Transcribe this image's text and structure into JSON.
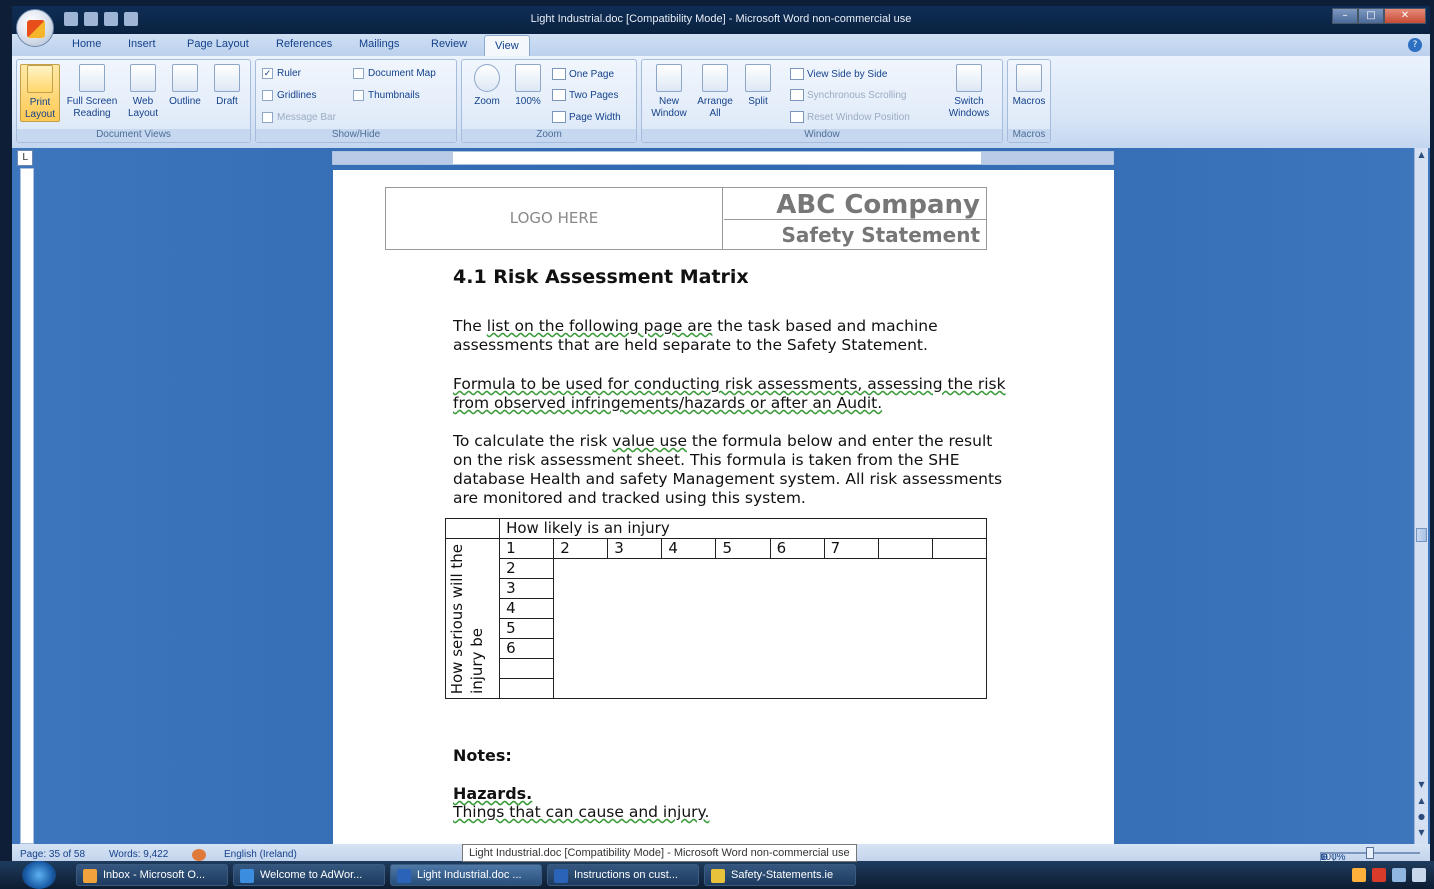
{
  "window": {
    "title": "Light Industrial.doc [Compatibility Mode] - Microsoft Word non-commercial use"
  },
  "ribbon_tabs": [
    "Home",
    "Insert",
    "Page Layout",
    "References",
    "Mailings",
    "Review",
    "View"
  ],
  "active_tab": "View",
  "groups": {
    "document_views": {
      "label": "Document Views",
      "print_layout": "Print Layout",
      "full_screen_reading": "Full Screen Reading",
      "web_layout": "Web Layout",
      "outline": "Outline",
      "draft": "Draft"
    },
    "show_hide": {
      "label": "Show/Hide",
      "ruler": "Ruler",
      "gridlines": "Gridlines",
      "message_bar": "Message Bar",
      "document_map": "Document Map",
      "thumbnails": "Thumbnails",
      "ruler_checked": true
    },
    "zoom": {
      "label": "Zoom",
      "zoom_btn": "Zoom",
      "hundred": "100%",
      "one_page": "One Page",
      "two_pages": "Two Pages",
      "page_width": "Page Width"
    },
    "window": {
      "label": "Window",
      "new_window": "New Window",
      "arrange_all": "Arrange All",
      "split": "Split",
      "view_side_by_side": "View Side by Side",
      "synchronous_scrolling": "Synchronous Scrolling",
      "reset_window_position": "Reset Window Position",
      "switch_windows": "Switch Windows"
    },
    "macros": {
      "label": "Macros",
      "macros_btn": "Macros"
    }
  },
  "document": {
    "logo": "LOGO HERE",
    "company": "ABC Company",
    "statement": "Safety Statement",
    "heading": "4.1 Risk Assessment Matrix",
    "p1_a": "The ",
    "p1_u": "list on the following page are",
    "p1_b": " the task based and machine assessments that are held separate to the Safety Statement.",
    "p2": "Formula to be used for conducting risk assessments, assessing the risk from observed infringements/hazards or after an Audit.",
    "p3_a": "To calculate the risk ",
    "p3_u": "value use",
    "p3_b": " the formula below and enter the result on the risk assessment sheet. This formula is taken from the SHE database Health and safety Management system. All risk assessments are monitored and tracked using this system.",
    "matrix": {
      "top_header": "How likely is an injury",
      "likely_values": [
        "1",
        "2",
        "3",
        "4",
        "5",
        "6",
        "7",
        "",
        ""
      ],
      "serious_values": [
        "2",
        "3",
        "4",
        "5",
        "6",
        "",
        ""
      ],
      "side_header_1": "How serious will the",
      "side_header_2": "injury be"
    },
    "notes": "Notes:",
    "hazards": "Hazards.",
    "hazards_text": "Things that can cause and injury."
  },
  "status_bar": {
    "page": "Page: 35 of 58",
    "words": "Words: 9,422",
    "language": "English (Ireland)",
    "zoom": "100%"
  },
  "tooltip": "Light Industrial.doc [Compatibility Mode] - Microsoft Word non-commercial use",
  "taskbar": {
    "items": [
      "Inbox - Microsoft O...",
      "Welcome to AdWor...",
      "Light Industrial.doc ...",
      "Instructions on cust...",
      "Safety-Statements.ie"
    ]
  },
  "colors": {
    "accent": "#15428b",
    "workspace": "#2f67b0",
    "title_bar": "#0f2d55"
  }
}
